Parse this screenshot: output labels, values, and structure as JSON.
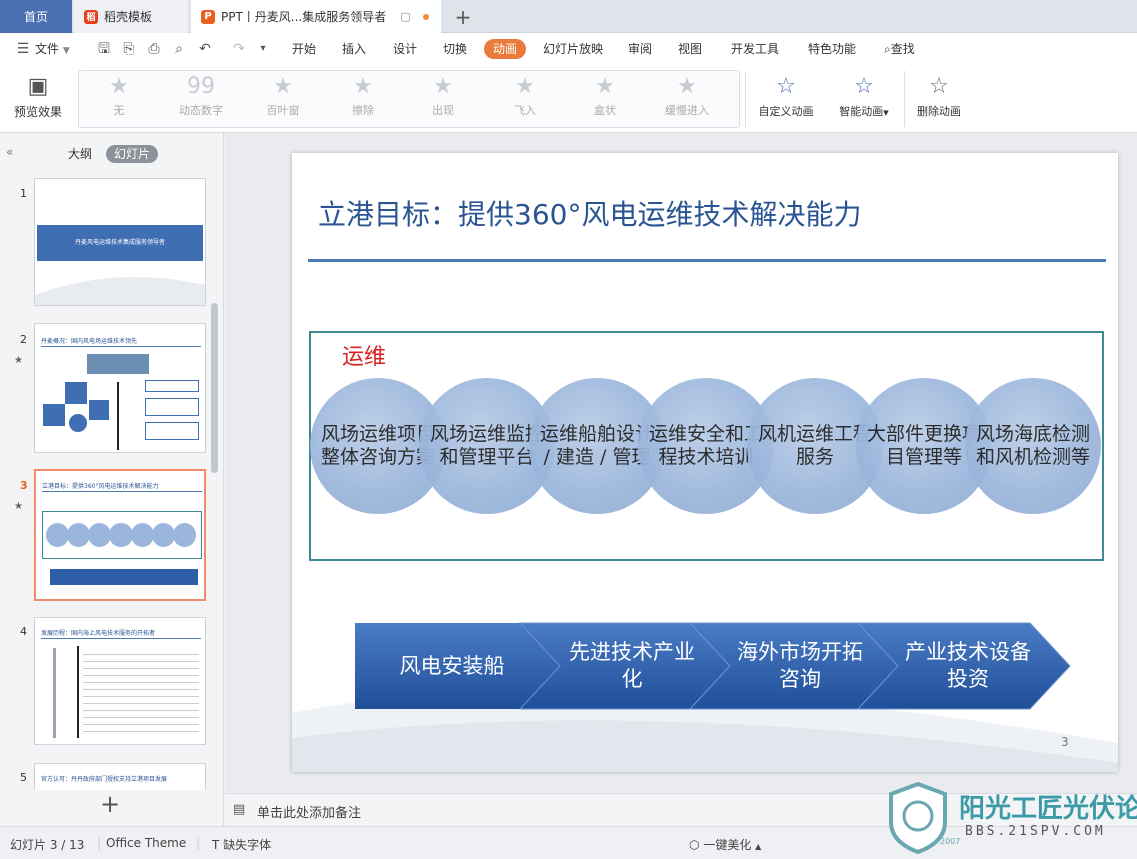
{
  "tabs": {
    "home": "首页",
    "docer": "稻壳模板",
    "ppt": "PPT丨丹麦风...集成服务领导者",
    "docer_logo": "稻",
    "ppt_logo": "P",
    "add_icon": "plus-icon"
  },
  "menu": {
    "file": "文件",
    "items": [
      "开始",
      "插入",
      "设计",
      "切换",
      "动画",
      "幻灯片放映",
      "审阅",
      "视图",
      "开发工具",
      "特色功能"
    ],
    "active": "动画",
    "search": "查找"
  },
  "ribbon": {
    "preview": "预览效果",
    "effects": [
      "无",
      "动态数字",
      "百叶窗",
      "擦除",
      "出现",
      "飞入",
      "盒状",
      "缓慢进入"
    ],
    "custom": "自定义动画",
    "smart": "智能动画",
    "delete": "删除动画"
  },
  "leftpanel": {
    "outline": "大纲",
    "slides": "幻灯片",
    "thumbs": [
      {
        "num": "1",
        "title": "丹麦风电运维技术集成服务领导者"
      },
      {
        "num": "2",
        "title": "丹麦概况：国内风电场运维技术领先"
      },
      {
        "num": "3",
        "title": "立港目标：提供360°风电运维技术解决能力"
      },
      {
        "num": "4",
        "title": "发展历程：国内海上风电技术服务的开拓者"
      },
      {
        "num": "5",
        "title": "官方认可：丹丹政府部门授权支持立港项目发展"
      }
    ]
  },
  "slide": {
    "title": "立港目标：提供360°风电运维技术解决能力",
    "box_label": "运维",
    "circles": [
      "风场运维项目整体咨询方案",
      "风场运维监控和管理平台",
      "运维船舶设计 / 建造 / 管理",
      "运维安全和工程技术培训",
      "风机运维工程服务",
      "大部件更换项目管理等",
      "风场海底检测和风机检测等"
    ],
    "chevrons": [
      "风电安装船",
      "先进技术产业化",
      "海外市场开拓咨询",
      "产业技术设备投资"
    ],
    "page": "3"
  },
  "notes": {
    "placeholder": "单击此处添加备注"
  },
  "status": {
    "slide_count": "幻灯片 3 / 13",
    "theme": "Office Theme",
    "missing_font": "缺失字体",
    "beautify": "一键美化"
  },
  "watermark": {
    "name": "阳光工匠光伏论坛",
    "url": "BBS.21SPV.COM",
    "year": "2007"
  },
  "colors": {
    "accent": "#ea7b3c",
    "title": "#2a5492",
    "chevron": "#2f5ea8",
    "circle": "#9bb6dc",
    "label_red": "#d91f1f"
  }
}
